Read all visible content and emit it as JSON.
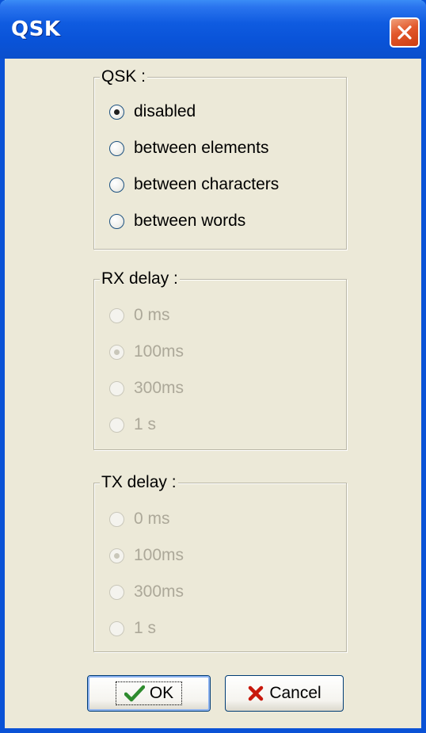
{
  "window": {
    "title": "QSK"
  },
  "groups": {
    "qsk": {
      "label": "QSK :",
      "options": [
        {
          "label": "disabled",
          "checked": true
        },
        {
          "label": "between elements",
          "checked": false
        },
        {
          "label": "between characters",
          "checked": false
        },
        {
          "label": "between words",
          "checked": false
        }
      ]
    },
    "rx_delay": {
      "label": "RX delay :",
      "enabled": false,
      "options": [
        {
          "label": "0 ms",
          "checked": false
        },
        {
          "label": "100ms",
          "checked": true
        },
        {
          "label": "300ms",
          "checked": false
        },
        {
          "label": "1 s",
          "checked": false
        }
      ]
    },
    "tx_delay": {
      "label": "TX delay :",
      "enabled": false,
      "options": [
        {
          "label": "0 ms",
          "checked": false
        },
        {
          "label": "100ms",
          "checked": true
        },
        {
          "label": "300ms",
          "checked": false
        },
        {
          "label": "1 s",
          "checked": false
        }
      ]
    }
  },
  "buttons": {
    "ok_label": "OK",
    "cancel_label": "Cancel"
  },
  "icons": {
    "ok": "checkmark-icon",
    "cancel": "x-icon",
    "close": "close-icon"
  },
  "colors": {
    "titlebar": "#0a52d6",
    "dialog_bg": "#ece9d8",
    "close_button": "#e2582b",
    "ok_check": "#2e8b2e",
    "cancel_x": "#c8180c",
    "disabled_text": "#aca899"
  }
}
